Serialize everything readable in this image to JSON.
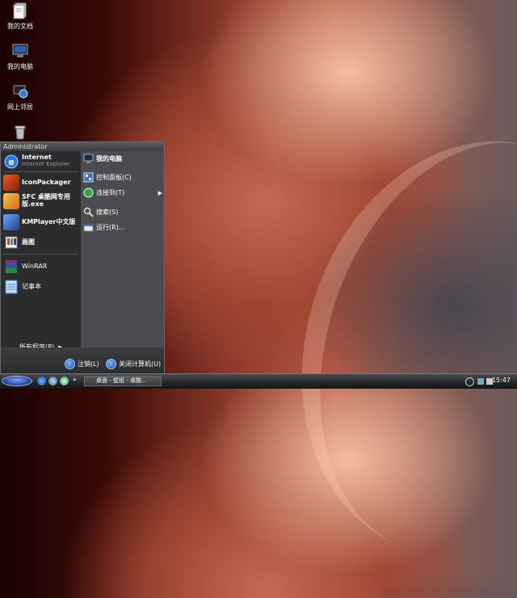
{
  "desktop": {
    "icons": [
      {
        "label": "我的文档",
        "icon": "my-documents-icon"
      },
      {
        "label": "我的电脑",
        "icon": "my-computer-icon"
      },
      {
        "label": "网上邻居",
        "icon": "network-places-icon"
      },
      {
        "label": "",
        "icon": "recycle-bin-icon"
      }
    ]
  },
  "start_menu": {
    "user": "Administrator",
    "pinned": [
      {
        "label": "Internet",
        "sub": "Internet Explorer",
        "icon": "internet-explorer-icon"
      }
    ],
    "programs": [
      {
        "label": "IconPackager",
        "icon": "iconpackager-icon"
      },
      {
        "label": "SFC 桌酷网专用版.exe",
        "icon": "sfc-icon"
      },
      {
        "label": "KMPlayer中文版",
        "icon": "kmplayer-icon"
      },
      {
        "label": "画图",
        "icon": "paint-icon"
      },
      {
        "label": "WinRAR",
        "icon": "winrar-icon"
      },
      {
        "label": "记事本",
        "icon": "notepad-icon"
      }
    ],
    "all_programs": "所有程序(P)",
    "right": [
      {
        "label": "我的电脑",
        "icon": "my-computer-icon",
        "bold": true
      },
      {
        "label": "控制面板(C)",
        "icon": "control-panel-icon"
      },
      {
        "label": "连接到(T)",
        "icon": "connect-to-icon",
        "arrow": true
      },
      {
        "label": "搜索(S)",
        "icon": "search-icon"
      },
      {
        "label": "运行(R)...",
        "icon": "run-icon"
      }
    ],
    "logoff": "注销(L)",
    "shutdown": "关闭计算机(U)"
  },
  "taskbar": {
    "task_button": "桌面 - 壁纸 - 桌酷...",
    "quick_launch": [
      "ie-icon",
      "show-desktop-icon",
      "media-icon"
    ],
    "overflow": "»",
    "clock": "15:47"
  }
}
